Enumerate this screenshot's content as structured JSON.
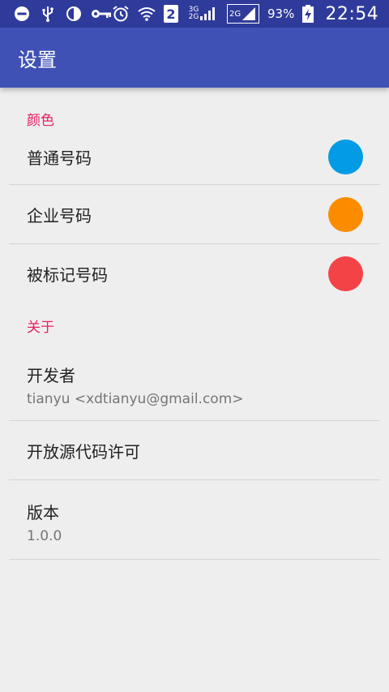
{
  "status_bar": {
    "battery_percent": "93%",
    "time": "22:54",
    "sim_badge": "2",
    "net_top": "3G",
    "net_bottom": "2G",
    "net_badge": "2G",
    "icons": [
      "do-not-disturb-icon",
      "usb-icon",
      "contrast-icon",
      "vpn-key-icon",
      "alarm-icon",
      "wifi-icon",
      "sim-2-icon",
      "signal-icon",
      "signal-icon-2",
      "battery-charging-icon"
    ]
  },
  "app_bar": {
    "title": "设置"
  },
  "sections": {
    "colors": {
      "header": "颜色",
      "items": [
        {
          "title": "普通号码",
          "color": "#039be5"
        },
        {
          "title": "企业号码",
          "color": "#fb8c00"
        },
        {
          "title": "被标记号码",
          "color": "#f44347"
        }
      ]
    },
    "about": {
      "header": "关于",
      "developer": {
        "title": "开发者",
        "summary": "tianyu <xdtianyu@gmail.com>"
      },
      "license": {
        "title": "开放源代码许可"
      },
      "version": {
        "title": "版本",
        "summary": "1.0.0"
      }
    }
  },
  "theme": {
    "primary": "#3f51b5",
    "primary_dark": "#2f3b9a",
    "accent": "#e91e63"
  }
}
